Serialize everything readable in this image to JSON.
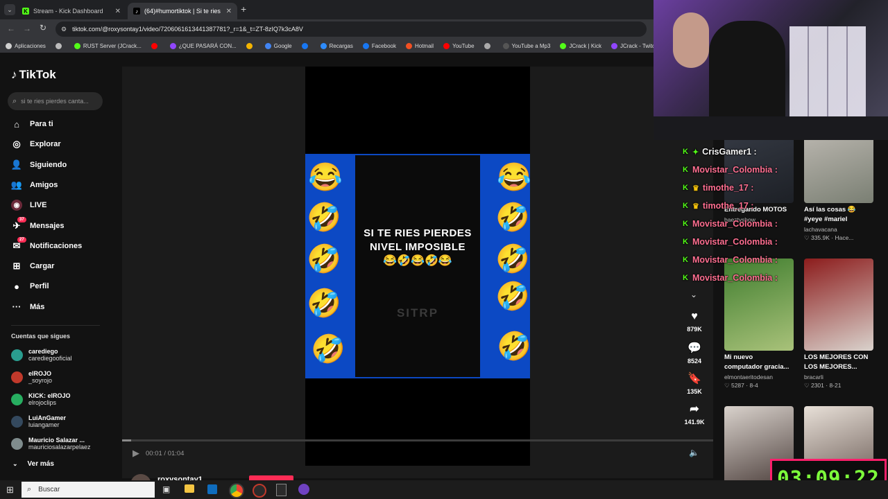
{
  "browser": {
    "tabs": [
      {
        "title": "Stream - Kick Dashboard",
        "icon": "kick-icon"
      },
      {
        "title": "(64)#humortiktok | Si te ries pie",
        "icon": "tiktok-icon"
      }
    ],
    "address": "tiktok.com/@roxysontay1/video/7206061613441387781?_r=1&_t=ZT-8zIQ7k3cA8V",
    "bookmarks": [
      {
        "label": "Aplicaciones",
        "color": "#cfcfcf"
      },
      {
        "label": "",
        "color": "#bbbbbb"
      },
      {
        "label": "RUST Server (JCrack...",
        "color": "#53fc18"
      },
      {
        "label": "",
        "color": "#ff0000"
      },
      {
        "label": "¿QUE PASARÁ CON...",
        "color": "#9146ff"
      },
      {
        "label": "",
        "color": "#f4b400"
      },
      {
        "label": "Google",
        "color": "#4285f4"
      },
      {
        "label": "",
        "color": "#1877f2"
      },
      {
        "label": "Recargas",
        "color": "#2d8cff"
      },
      {
        "label": "Facebook",
        "color": "#1877f2"
      },
      {
        "label": "Hotmail",
        "color": "#f25022"
      },
      {
        "label": "YouTube",
        "color": "#ff0000"
      },
      {
        "label": "",
        "color": "#aaaaaa"
      },
      {
        "label": "YouTube a Mp3",
        "color": "#555555"
      },
      {
        "label": "JCrack | Kick",
        "color": "#53fc18"
      },
      {
        "label": "JCrack - Twitch",
        "color": "#9146ff"
      },
      {
        "label": "JCrack",
        "color": "#ffffff"
      }
    ]
  },
  "tiktok": {
    "logo": "TikTok",
    "search_placeholder": "si te ries pierdes canta...",
    "nav": [
      {
        "label": "Para ti",
        "icon": "home-icon",
        "glyph": "⌂"
      },
      {
        "label": "Explorar",
        "icon": "compass-icon",
        "glyph": "◎"
      },
      {
        "label": "Siguiendo",
        "icon": "following-icon",
        "glyph": "👤"
      },
      {
        "label": "Amigos",
        "icon": "friends-icon",
        "glyph": "👥"
      },
      {
        "label": "LIVE",
        "icon": "live-icon",
        "glyph": "◉"
      },
      {
        "label": "Mensajes",
        "icon": "messages-icon",
        "glyph": "✈",
        "badge": "37"
      },
      {
        "label": "Notificaciones",
        "icon": "bell-icon",
        "glyph": "✉",
        "badge": "27"
      },
      {
        "label": "Cargar",
        "icon": "upload-icon",
        "glyph": "⊞"
      },
      {
        "label": "Perfil",
        "icon": "profile-icon",
        "glyph": "●"
      },
      {
        "label": "Más",
        "icon": "more-icon",
        "glyph": "···"
      }
    ],
    "following_header": "Cuentas que sigues",
    "following": [
      {
        "name": "carediego",
        "handle": "carediegooficial",
        "color": "#2a9d8f"
      },
      {
        "name": "elROJO",
        "handle": "_soyrojo",
        "color": "#c0392b"
      },
      {
        "name": "KICK: elROJO",
        "handle": "elrojoclips",
        "color": "#27ae60"
      },
      {
        "name": "LuiAnGamer",
        "handle": "luiangamer",
        "color": "#34495e"
      },
      {
        "name": "Mauricio Salazar ...",
        "handle": "mauriciosalazarpelaez",
        "color": "#7f8c8d"
      }
    ],
    "see_more": "Ver más",
    "video": {
      "overlay_line1": "SI TE RIES PIERDES",
      "overlay_line2": "NIVEL IMPOSIBLE",
      "overlay_emojis": "😂🤣😂🤣😂",
      "watermark": "SITRP",
      "time": "00:01 / 01:04",
      "progress": 0.015
    },
    "author": "roxysontay1",
    "actions": [
      {
        "icon": "heart-icon",
        "glyph": "♥",
        "count": "879K"
      },
      {
        "icon": "comment-icon",
        "glyph": "💬",
        "count": "8524"
      },
      {
        "icon": "bookmark-icon",
        "glyph": "🔖",
        "count": "135K"
      },
      {
        "icon": "share-icon",
        "glyph": "➦",
        "count": "141.9K"
      }
    ],
    "recommended": [
      {
        "title1": "Entregando MOTOS",
        "title2": "",
        "user": "baeztvshow",
        "stats": "",
        "colorA": "#3a3f4a",
        "colorB": "#1d2026"
      },
      {
        "title1": "Así las cosas 😂",
        "title2": "#yeye #mariel",
        "user": "lachavacana",
        "stats": "♡ 335.9K · Hace...",
        "colorA": "#c9c3bd",
        "colorB": "#7a7f73"
      },
      {
        "title1": "Mi nuevo",
        "title2": "computador gracia...",
        "user": "elmontaeritodesan",
        "stats": "♡ 5287 · 8-4",
        "colorA": "#3f7d2e",
        "colorB": "#a9c27a"
      },
      {
        "title1": "LOS MEJORES CON",
        "title2": "LOS MEJORES...",
        "user": "bracarli",
        "stats": "♡ 2301 · 8-21",
        "colorA": "#8c1c1c",
        "colorB": "#d9d2cc"
      },
      {
        "title1": "",
        "title2": "",
        "user": "",
        "stats": "",
        "colorA": "#d9d2cc",
        "colorB": "#3b2d2a"
      },
      {
        "title1": "",
        "title2": "",
        "user": "",
        "stats": "",
        "colorA": "#e8e0d8",
        "colorB": "#5a4a44"
      }
    ]
  },
  "chat": [
    {
      "user": "CrisGamer1 :",
      "color": "#f5f5f5",
      "badge": "✦",
      "badgeColor": "#53fc18"
    },
    {
      "user": "Movistar_Colombia :",
      "color": "#ff6f91",
      "badge": "",
      "badgeColor": ""
    },
    {
      "user": "timothe_17 :",
      "color": "#ff6f91",
      "badge": "♛",
      "badgeColor": "#f4c20d"
    },
    {
      "user": "timothe_17 :",
      "color": "#ff6f91",
      "badge": "♛",
      "badgeColor": "#f4c20d"
    },
    {
      "user": "Movistar_Colombia :",
      "color": "#ff6f91",
      "badge": "",
      "badgeColor": ""
    },
    {
      "user": "Movistar_Colombia :",
      "color": "#ff6f91",
      "badge": "",
      "badgeColor": ""
    },
    {
      "user": "Movistar_Colombia :",
      "color": "#ff6f91",
      "badge": "",
      "badgeColor": ""
    },
    {
      "user": "Movistar_Colombia :",
      "color": "#ff6f91",
      "badge": "",
      "badgeColor": ""
    }
  ],
  "timer": "03:09:22",
  "taskbar": {
    "search_label": "Buscar"
  }
}
